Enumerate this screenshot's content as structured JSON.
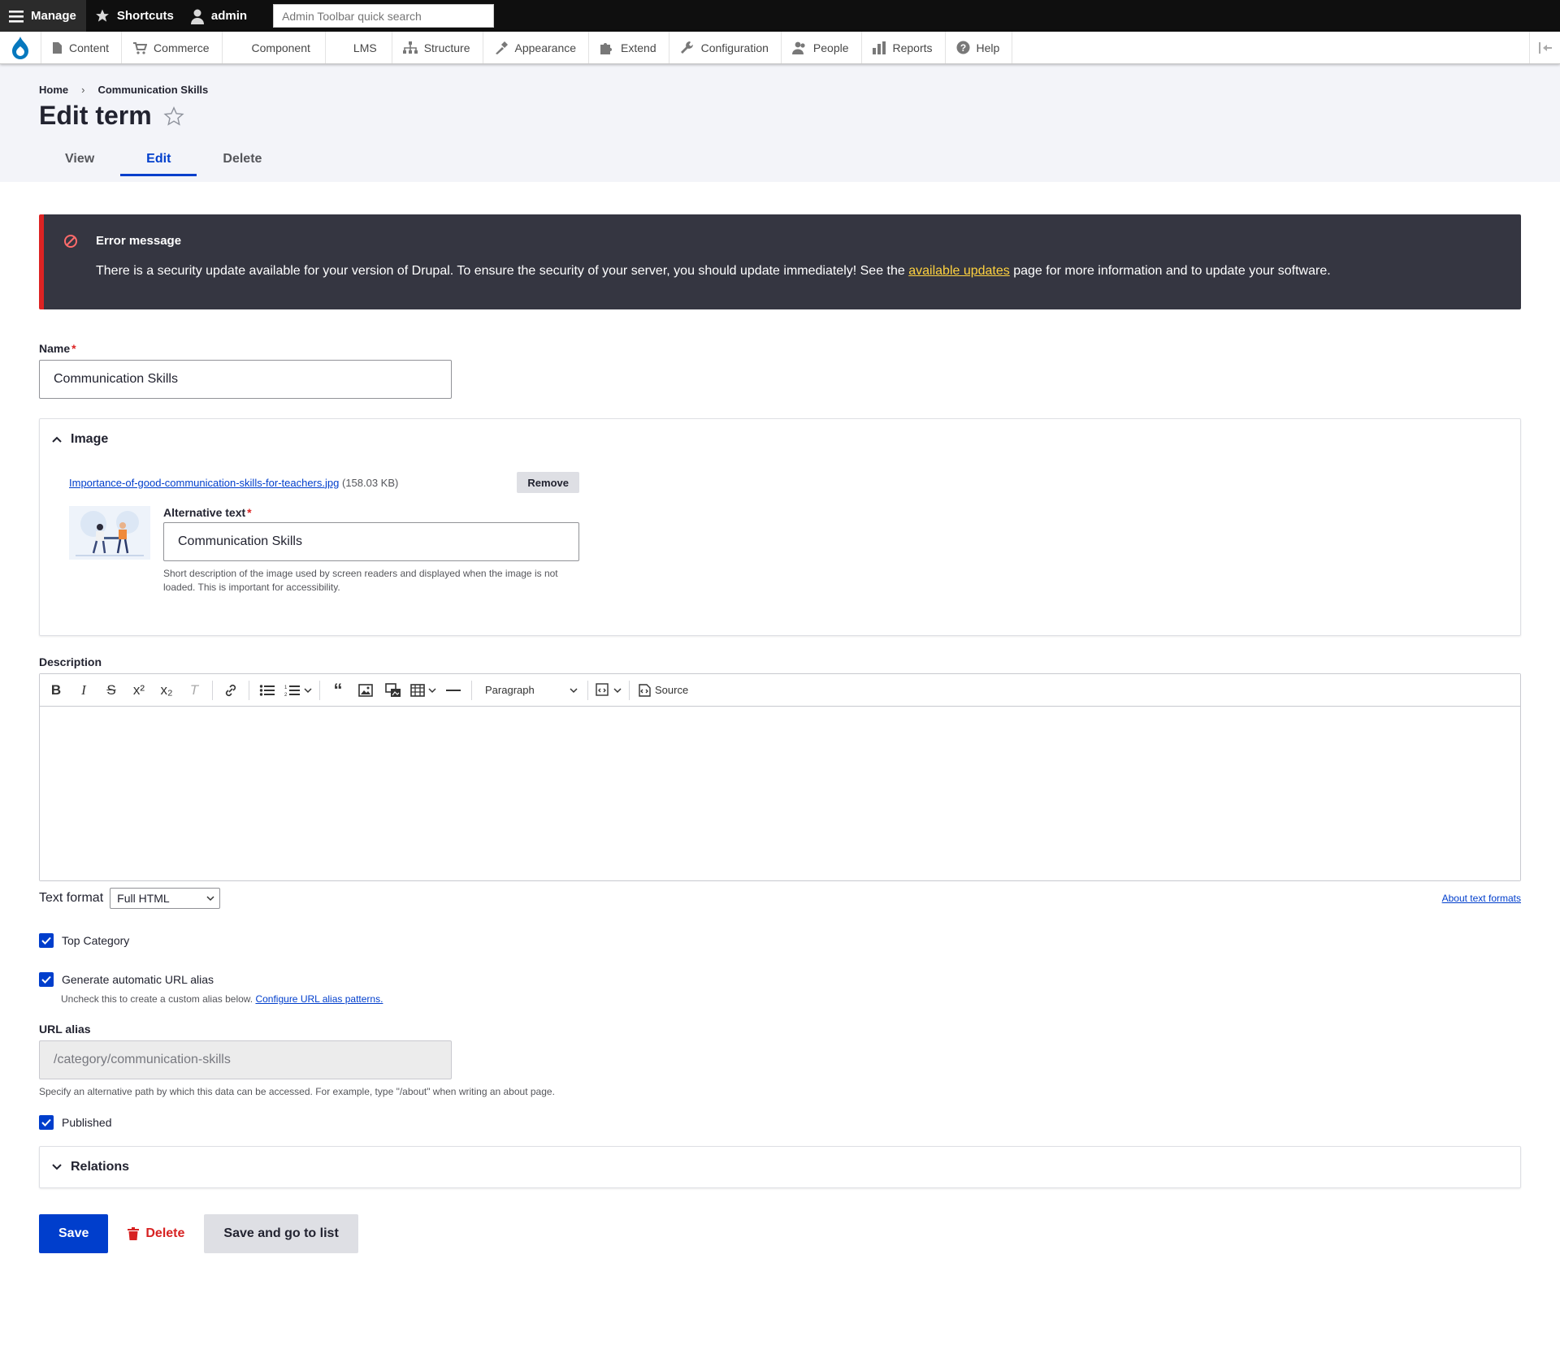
{
  "toolbar": {
    "manage": "Manage",
    "shortcuts": "Shortcuts",
    "user": "admin",
    "search_placeholder": "Admin Toolbar quick search"
  },
  "tray": {
    "items": [
      {
        "label": "Content",
        "icon": "page-icon"
      },
      {
        "label": "Commerce",
        "icon": "cart-icon"
      },
      {
        "label": "Component",
        "icon": ""
      },
      {
        "label": "LMS",
        "icon": ""
      },
      {
        "label": "Structure",
        "icon": "sitemap-icon"
      },
      {
        "label": "Appearance",
        "icon": "brush-icon"
      },
      {
        "label": "Extend",
        "icon": "puzzle-icon"
      },
      {
        "label": "Configuration",
        "icon": "wrench-icon"
      },
      {
        "label": "People",
        "icon": "people-icon"
      },
      {
        "label": "Reports",
        "icon": "bar-chart-icon"
      },
      {
        "label": "Help",
        "icon": "help-icon"
      }
    ]
  },
  "breadcrumb": {
    "home": "Home",
    "sep": "›",
    "current": "Communication Skills"
  },
  "page": {
    "title": "Edit term"
  },
  "tabs": [
    "View",
    "Edit",
    "Delete"
  ],
  "error": {
    "title": "Error message",
    "text_before": "There is a security update available for your version of Drupal. To ensure the security of your server, you should update immediately! See the ",
    "link": "available updates",
    "text_after": " page for more information and to update your software."
  },
  "name_field": {
    "label": "Name",
    "value": "Communication Skills"
  },
  "image": {
    "legend": "Image",
    "file_name": "Importance-of-good-communication-skills-for-teachers.jpg",
    "file_size": "(158.03 KB)",
    "remove": "Remove",
    "alt_label": "Alternative text",
    "alt_value": "Communication Skills",
    "alt_help": "Short description of the image used by screen readers and displayed when the image is not loaded. This is important for accessibility."
  },
  "description": {
    "label": "Description",
    "paragraph": "Paragraph",
    "source": "Source"
  },
  "text_format": {
    "label": "Text format",
    "value": "Full HTML",
    "about": "About text formats"
  },
  "top_category": {
    "label": "Top Category"
  },
  "url_auto": {
    "label": "Generate automatic URL alias",
    "help_before": "Uncheck this to create a custom alias below. ",
    "help_link": "Configure URL alias patterns."
  },
  "url_alias": {
    "label": "URL alias",
    "value": "/category/communication-skills",
    "help": "Specify an alternative path by which this data can be accessed. For example, type \"/about\" when writing an about page."
  },
  "published": {
    "label": "Published"
  },
  "relations": {
    "legend": "Relations"
  },
  "actions": {
    "save": "Save",
    "delete": "Delete",
    "save_list": "Save and go to list"
  },
  "colors": {
    "primary": "#003ecc",
    "error_bg": "#353641",
    "error_accent": "#dc2323",
    "link_warn": "#ffd23f"
  }
}
